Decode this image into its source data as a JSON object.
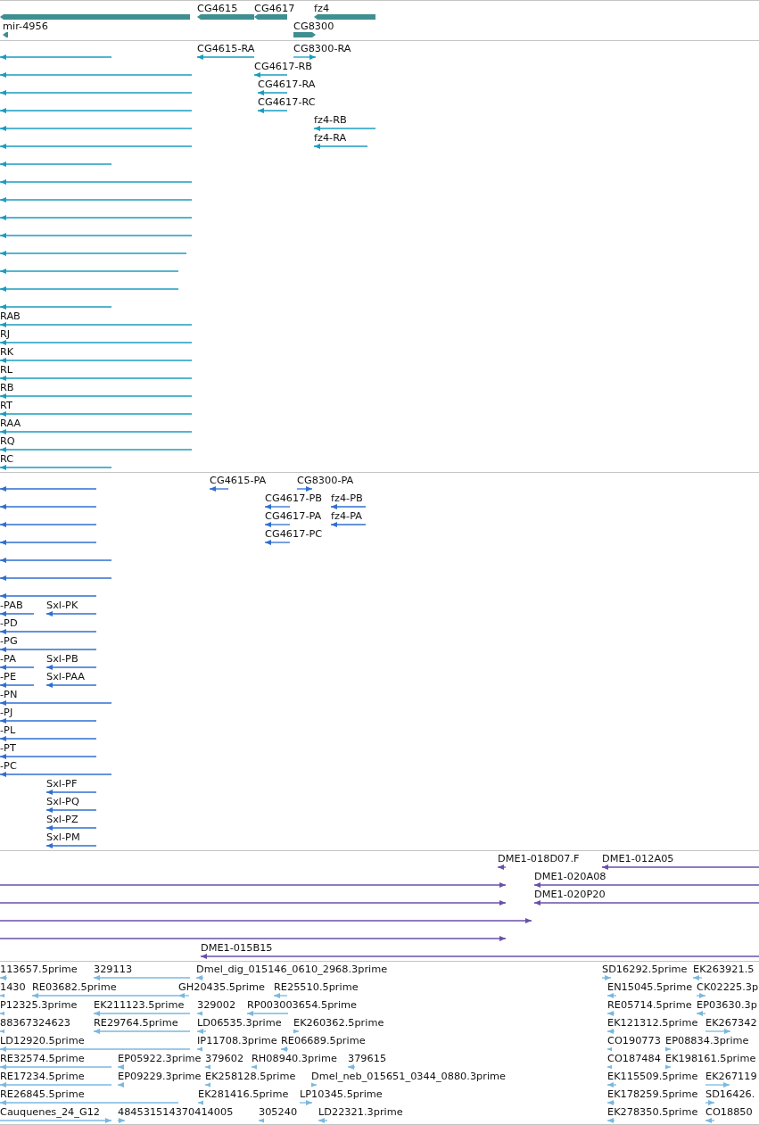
{
  "tracks": [
    {
      "kind": "gene",
      "features": [
        "CG4615",
        "CG4617",
        "fz4",
        "mir-4956",
        "CG8300"
      ]
    },
    {
      "kind": "transcript",
      "features": [
        "CG4615-RA",
        "CG8300-RA",
        "CG4617-RB",
        "CG4617-RA",
        "CG4617-RC",
        "fz4-RB",
        "fz4-RA",
        "RAB",
        "RJ",
        "RK",
        "RL",
        "RB",
        "RT",
        "RAA",
        "RQ",
        "RC"
      ]
    },
    {
      "kind": "protein",
      "features": [
        "CG4615-PA",
        "CG8300-PA",
        "CG4617-PB",
        "fz4-PB",
        "CG4617-PA",
        "fz4-PA",
        "CG4617-PC",
        "-PAB",
        "Sxl-PK",
        "-PD",
        "-PG",
        "-PA",
        "Sxl-PB",
        "-PE",
        "Sxl-PAA",
        "-PN",
        "-PJ",
        "-PL",
        "-PT",
        "-PC",
        "Sxl-PF",
        "Sxl-PQ",
        "Sxl-PZ",
        "Sxl-PM"
      ]
    },
    {
      "kind": "clone",
      "features": [
        "DME1-018D07.F",
        "DME1-012A05",
        "DME1-020A08",
        "DME1-020P20",
        "DME1-015B15"
      ]
    },
    {
      "kind": "est",
      "features": [
        "113657.5prime",
        "329113",
        "Dmel_dig_015146_0610_2968.3prime",
        "SD16292.5prime",
        "EK263921.5",
        "1430",
        "RE03682.5prime",
        "GH20435.5prime",
        "RE25510.5prime",
        "EN15045.5prime",
        "CK02225.3p",
        "P12325.3prime",
        "EK211123.5prime",
        "329002",
        "RP003003654.5prime",
        "RE05714.5prime",
        "EP03630.3p",
        "88367324623",
        "RE29764.5prime",
        "LD06535.3prime",
        "EK260362.5prime",
        "EK121312.5prime",
        "EK267342",
        "LD12920.5prime",
        "IP11708.3prime",
        "RE06689.5prime",
        "CO190773",
        "EP08834.3prime",
        "RE32574.5prime",
        "EP05922.3prime",
        "379602",
        "RH08940.3prime",
        "379615",
        "CO187484",
        "EK198161.5prime",
        "RE17234.5prime",
        "EP09229.3prime",
        "EK258128.5prime",
        "Dmel_neb_015651_0344_0880.3prime",
        "EK115509.5prime",
        "EK267119",
        "RE26845.5prime",
        "EK281416.5prime",
        "LP10345.5prime",
        "EK178259.5prime",
        "SD16426.",
        "Cauquenes_24_G12",
        "484531514370414005",
        "305240",
        "LD22321.3prime",
        "EK278350.5prime",
        "CO18850"
      ]
    }
  ]
}
